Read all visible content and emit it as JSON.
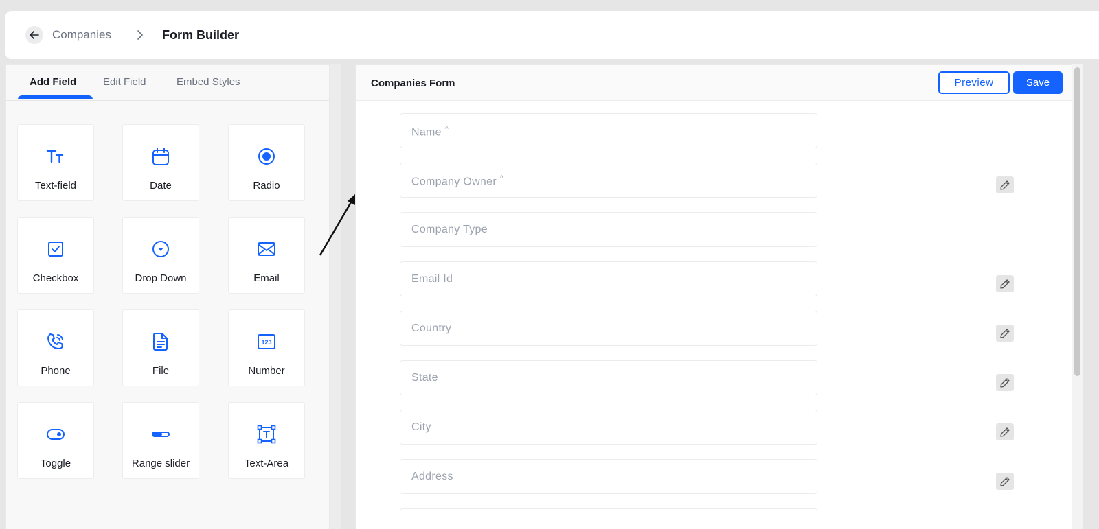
{
  "breadcrumb": {
    "back_icon": "arrow-left-icon",
    "parent": "Companies",
    "separator_icon": "chevron-right-icon",
    "current": "Form Builder"
  },
  "left_panel": {
    "tabs": [
      {
        "label": "Add Field",
        "active": true
      },
      {
        "label": "Edit Field",
        "active": false
      },
      {
        "label": "Embed Styles",
        "active": false
      }
    ],
    "fields": [
      {
        "label": "Text-field",
        "icon": "text-format-icon"
      },
      {
        "label": "Date",
        "icon": "calendar-icon"
      },
      {
        "label": "Radio",
        "icon": "radio-icon"
      },
      {
        "label": "Checkbox",
        "icon": "checkbox-icon"
      },
      {
        "label": "Drop Down",
        "icon": "dropdown-circle-icon"
      },
      {
        "label": "Email",
        "icon": "envelope-icon"
      },
      {
        "label": "Phone",
        "icon": "phone-icon"
      },
      {
        "label": "File",
        "icon": "file-icon"
      },
      {
        "label": "Number",
        "icon": "number-123-icon"
      },
      {
        "label": "Toggle",
        "icon": "toggle-icon"
      },
      {
        "label": "Range slider",
        "icon": "range-slider-icon"
      },
      {
        "label": "Text-Area",
        "icon": "text-area-icon"
      }
    ]
  },
  "form": {
    "title": "Companies Form",
    "preview_label": "Preview",
    "save_label": "Save",
    "fields": [
      {
        "placeholder": "Name",
        "mark": "^",
        "editable": false
      },
      {
        "placeholder": "Company Owner",
        "mark": "^",
        "editable": true
      },
      {
        "placeholder": "Company Type",
        "mark": "",
        "editable": false
      },
      {
        "placeholder": "Email Id",
        "mark": "",
        "editable": true
      },
      {
        "placeholder": "Country",
        "mark": "",
        "editable": true
      },
      {
        "placeholder": "State",
        "mark": "",
        "editable": true
      },
      {
        "placeholder": "City",
        "mark": "",
        "editable": true
      },
      {
        "placeholder": "Address",
        "mark": "",
        "editable": true
      },
      {
        "placeholder": "",
        "mark": "",
        "editable": false
      }
    ]
  },
  "colors": {
    "accent": "#1463ff",
    "background": "#e6e6e6",
    "placeholder": "#9ca3af"
  }
}
